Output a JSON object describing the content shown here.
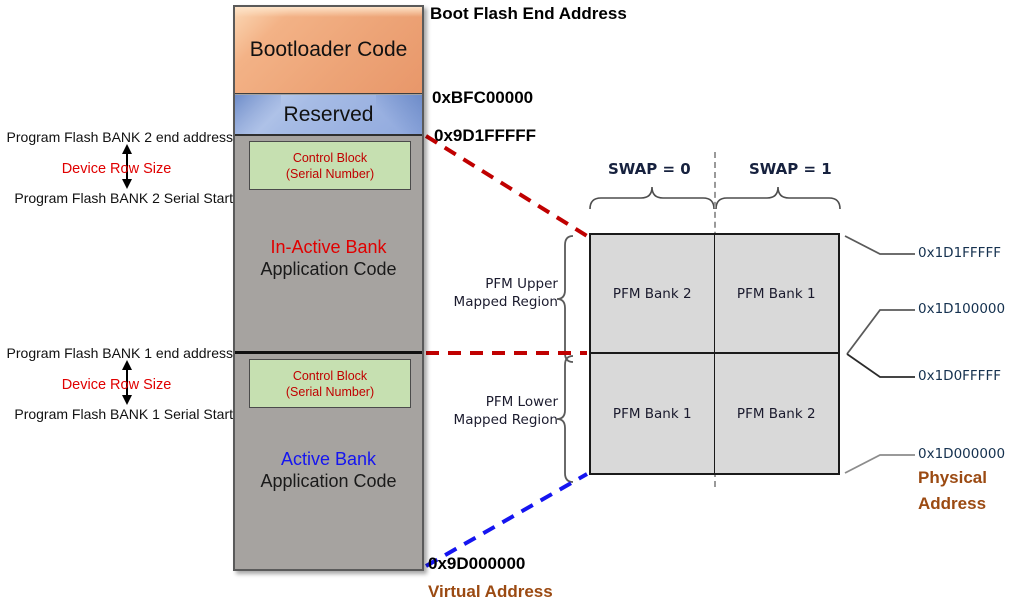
{
  "memory_map": {
    "segments": [
      {
        "id": "bootloader",
        "label": "Bootloader Code"
      },
      {
        "id": "reserved",
        "label": "Reserved"
      },
      {
        "id": "inactive",
        "name": "In-Active Bank",
        "sub": "Application Code",
        "name_color": "#e00000"
      },
      {
        "id": "active",
        "name": "Active Bank",
        "sub": "Application Code",
        "name_color": "#1515f0"
      }
    ],
    "control_blocks": [
      {
        "line1": "Control Block",
        "line2": "(Serial Number)"
      },
      {
        "line1": "Control Block",
        "line2": "(Serial Number)"
      }
    ],
    "addresses": {
      "boot_flash_end": "Boot Flash End Address",
      "bfc00000": "0xBFC00000",
      "bank2_end": "0x9D1FFFFF",
      "bank1_start": "0x9D000000",
      "virtual_address": "Virtual Address"
    },
    "left_labels": {
      "bank2_end_address": "Program Flash BANK 2 end address",
      "bank2_serial_start": "Program Flash BANK 2 Serial Start",
      "bank1_end_address": "Program Flash BANK 1 end address",
      "bank1_serial_start": "Program Flash BANK 1 Serial Start",
      "device_row_size_upper": "Device Row Size",
      "device_row_size_lower": "Device Row Size"
    }
  },
  "mapping": {
    "swap_labels": [
      {
        "text": "SWAP = 0"
      },
      {
        "text": "SWAP = 1"
      }
    ],
    "region_labels": [
      {
        "line1": "PFM Upper",
        "line2": "Mapped Region"
      },
      {
        "line1": "PFM Lower",
        "line2": "Mapped Region"
      }
    ],
    "cells": {
      "upper_left": "PFM Bank 2",
      "upper_right": "PFM Bank 1",
      "lower_left": "PFM Bank 1",
      "lower_right": "PFM Bank 2"
    },
    "physical_addresses": {
      "top": "0x1D1FFFFF",
      "mid_high": "0x1D100000",
      "mid_low": "0x1D0FFFFF",
      "bottom": "0x1D000000",
      "caption_line1": "Physical",
      "caption_line2": "Address"
    }
  },
  "colors": {
    "bootloader": "#EDA477",
    "reserved": "#9EB5E0",
    "control_block": "#C6E0B1",
    "bank_gray": "#A6A3A0",
    "grid_gray": "#D9D9D9",
    "accent_red": "#C00000",
    "accent_blue": "#1515F0",
    "brown": "#9B4A12"
  }
}
